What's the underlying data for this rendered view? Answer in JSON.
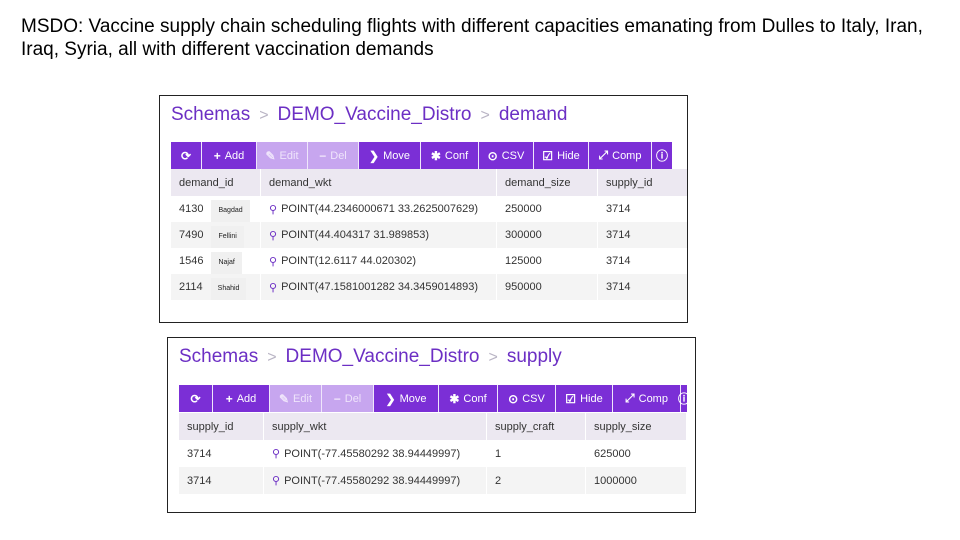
{
  "slide": {
    "title": "MSDO: Vaccine supply chain scheduling flights with different capacities emanating from Dulles to Italy, Iran, Iraq, Syria,  all with different vaccination demands"
  },
  "colors": {
    "accent": "#7b2fd6",
    "accent_disabled": "#c7a6ef",
    "link": "#6c2fc4"
  },
  "toolbar_buttons": [
    {
      "label": "",
      "icon": "refresh-icon",
      "glyph": "⟳",
      "disabled": false
    },
    {
      "label": "Add",
      "icon": "plus-icon",
      "glyph": "+",
      "disabled": false
    },
    {
      "label": "Edit",
      "icon": "pencil-icon",
      "glyph": "✎",
      "disabled": true
    },
    {
      "label": "Del",
      "icon": "minus-icon",
      "glyph": "−",
      "disabled": true
    },
    {
      "label": "Move",
      "icon": "chevron-right-icon",
      "glyph": "❯",
      "disabled": false
    },
    {
      "label": "Conf",
      "icon": "gear-icon",
      "glyph": "✱",
      "disabled": false
    },
    {
      "label": "CSV",
      "icon": "download-circle-icon",
      "glyph": "⊙",
      "disabled": false
    },
    {
      "label": "Hide",
      "icon": "check-square-icon",
      "glyph": "☑",
      "disabled": false
    },
    {
      "label": "Comp",
      "icon": "wand-icon",
      "glyph": "⤢",
      "disabled": false
    },
    {
      "label": "",
      "icon": "info-icon",
      "glyph": "ⓘ",
      "disabled": false
    }
  ],
  "demand": {
    "breadcrumb": [
      "Schemas",
      "DEMO_Vaccine_Distro",
      "demand"
    ],
    "columns": [
      "demand_id",
      "demand_wkt",
      "demand_size",
      "supply_id"
    ],
    "rows": [
      {
        "id": "4130",
        "city": "Bagdad",
        "wkt": "POINT(44.2346000671 33.2625007629)",
        "size": "250000",
        "supply_id": "3714"
      },
      {
        "id": "7490",
        "city": "Fellini",
        "wkt": "POINT(44.404317 31.989853)",
        "size": "300000",
        "supply_id": "3714"
      },
      {
        "id": "1546",
        "city": "Najaf",
        "wkt": "POINT(12.6117 44.020302)",
        "size": "125000",
        "supply_id": "3714"
      },
      {
        "id": "2114",
        "city": "Shahid",
        "wkt": "POINT(47.1581001282 34.3459014893)",
        "size": "950000",
        "supply_id": "3714"
      }
    ]
  },
  "supply": {
    "breadcrumb": [
      "Schemas",
      "DEMO_Vaccine_Distro",
      "supply"
    ],
    "columns": [
      "supply_id",
      "supply_wkt",
      "supply_craft",
      "supply_size"
    ],
    "rows": [
      {
        "id": "3714",
        "wkt": "POINT(-77.45580292 38.94449997)",
        "craft": "1",
        "size": "625000"
      },
      {
        "id": "3714",
        "wkt": "POINT(-77.45580292 38.94449997)",
        "craft": "2",
        "size": "1000000"
      }
    ]
  }
}
